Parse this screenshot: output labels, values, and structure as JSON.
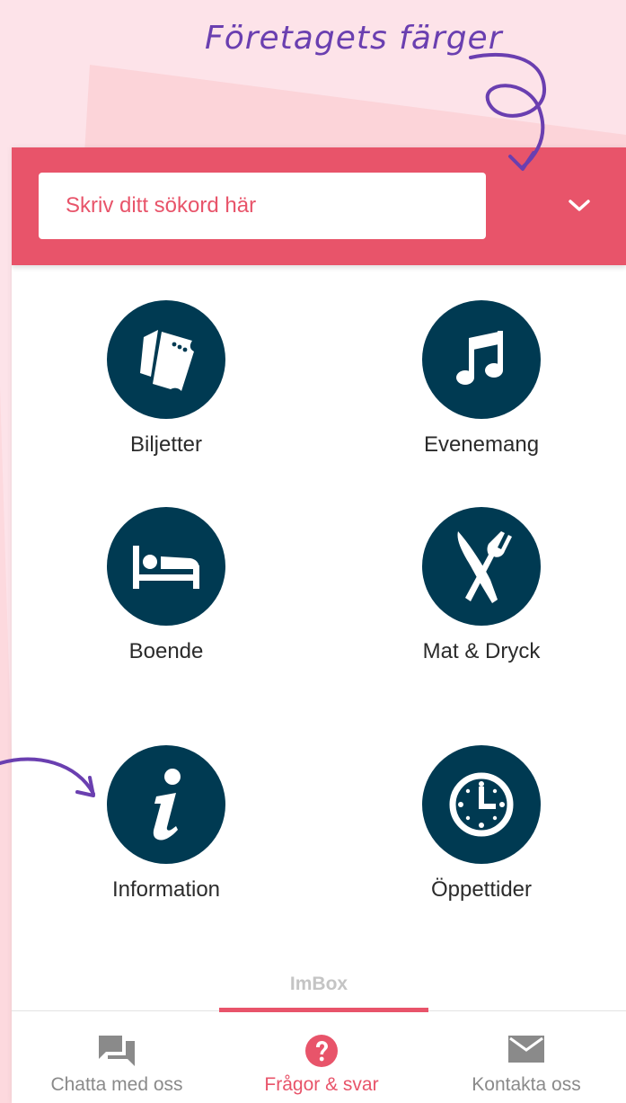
{
  "annotation": {
    "text": "Företagets färger"
  },
  "colors": {
    "accent": "#e8546a",
    "icon_circle": "#003a52",
    "annotation": "#6a3fb0",
    "background": "#fde3e9"
  },
  "search": {
    "placeholder": "Skriv ditt sökord här",
    "dropdown_icon": "chevron-down-icon"
  },
  "categories": [
    {
      "label": "Biljetter",
      "icon": "ticket-icon"
    },
    {
      "label": "Evenemang",
      "icon": "music-note-icon"
    },
    {
      "label": "Boende",
      "icon": "bed-icon"
    },
    {
      "label": "Mat & Dryck",
      "icon": "knife-fork-icon"
    },
    {
      "label": "Information",
      "icon": "info-icon"
    },
    {
      "label": "Öppettider",
      "icon": "clock-icon"
    }
  ],
  "brand": {
    "text": "ImBox"
  },
  "tabs": [
    {
      "label": "Chatta med oss",
      "icon": "chat-icon",
      "active": false
    },
    {
      "label": "Frågor & svar",
      "icon": "question-icon",
      "active": true
    },
    {
      "label": "Kontakta oss",
      "icon": "mail-icon",
      "active": false
    }
  ]
}
